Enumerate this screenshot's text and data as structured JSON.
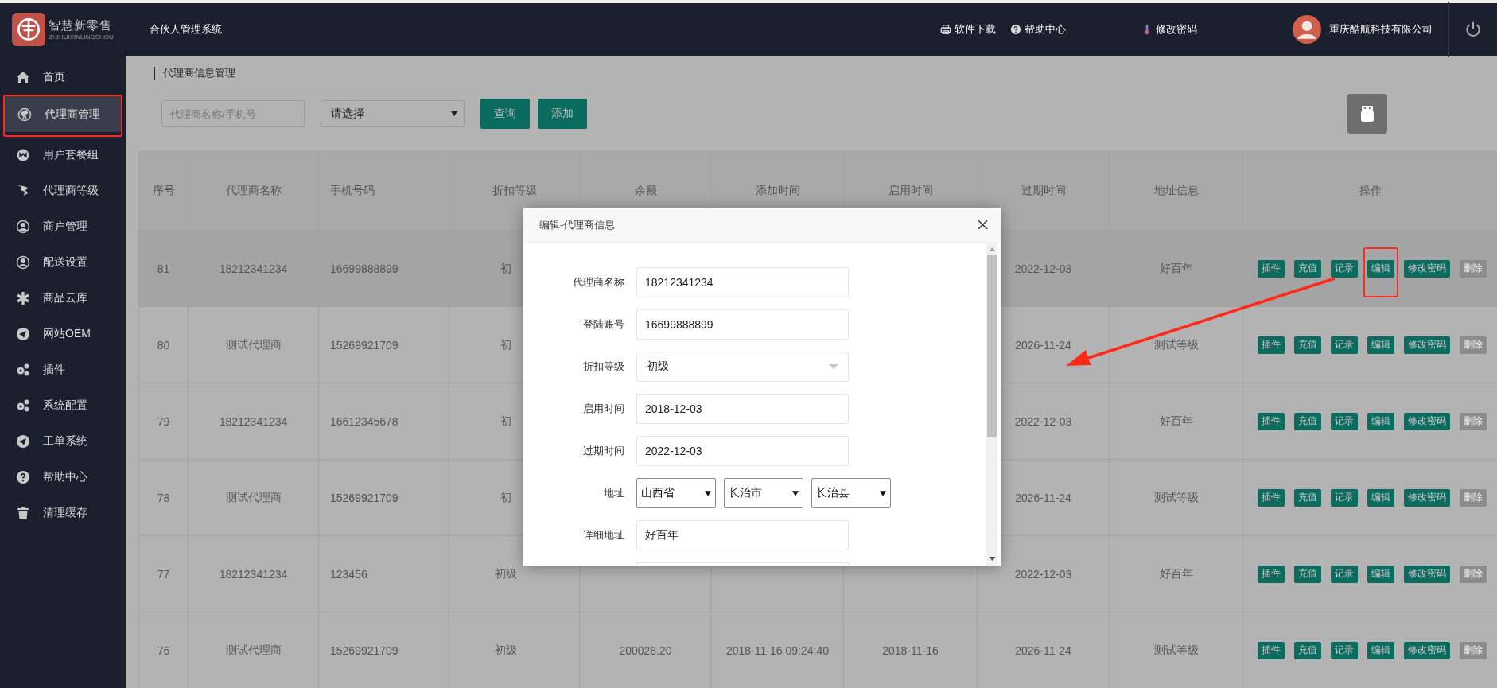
{
  "brand": {
    "name": "智慧新零售",
    "subtitle": "ZHIHUIXINLINGSHOU"
  },
  "system_title": "合伙人管理系统",
  "top_links": [
    {
      "label": "软件下载"
    },
    {
      "label": "帮助中心"
    },
    {
      "label": "修改密码"
    }
  ],
  "user": {
    "company": "重庆酷航科技有限公司"
  },
  "sidebar": {
    "items": [
      {
        "label": "首页",
        "selected": false,
        "highlighted": false
      },
      {
        "label": "代理商管理",
        "selected": true,
        "highlighted": true
      },
      {
        "label": "用户套餐组",
        "selected": false,
        "highlighted": false
      },
      {
        "label": "代理商等级",
        "selected": false,
        "highlighted": false
      },
      {
        "label": "商户管理",
        "selected": false,
        "highlighted": false
      },
      {
        "label": "配送设置",
        "selected": false,
        "highlighted": false
      },
      {
        "label": "商品云库",
        "selected": false,
        "highlighted": false
      },
      {
        "label": "网站OEM",
        "selected": false,
        "highlighted": false
      },
      {
        "label": "插件",
        "selected": false,
        "highlighted": false
      },
      {
        "label": "系统配置",
        "selected": false,
        "highlighted": false
      },
      {
        "label": "工单系统",
        "selected": false,
        "highlighted": false
      },
      {
        "label": "帮助中心",
        "selected": false,
        "highlighted": false
      },
      {
        "label": "清理缓存",
        "selected": false,
        "highlighted": false
      }
    ]
  },
  "breadcrumb": "代理商信息管理",
  "filters": {
    "search": {
      "placeholder": "代理商名称/手机号"
    },
    "select": {
      "value": "请选择"
    },
    "buttons": [
      "查询",
      "添加"
    ]
  },
  "table": {
    "columns": [
      "序号",
      "代理商名称",
      "手机号码",
      "折扣等级",
      "余额",
      "添加时间",
      "启用时间",
      "过期时间",
      "地址信息",
      "操作"
    ],
    "rows": [
      {
        "no": "81",
        "name": "18212341234",
        "phone": "16699888899",
        "discount": "初",
        "expire_time": "2022-12-03",
        "address": "好百年",
        "hovered": true,
        "actions": [
          {
            "label": "插件",
            "disabled": false,
            "highlighted": false
          },
          {
            "label": "充值",
            "disabled": false,
            "highlighted": false
          },
          {
            "label": "记录",
            "disabled": false,
            "highlighted": false
          },
          {
            "label": "编辑",
            "disabled": false,
            "highlighted": true
          },
          {
            "label": "修改密码",
            "disabled": false,
            "highlighted": false
          },
          {
            "label": "删除",
            "disabled": true,
            "highlighted": false
          }
        ]
      },
      {
        "no": "80",
        "name": "测试代理商",
        "phone": "15269921709",
        "discount": "初",
        "expire_time": "2026-11-24",
        "address": "测试等级",
        "hovered": false,
        "actions": [
          {
            "label": "插件",
            "disabled": false,
            "highlighted": false
          },
          {
            "label": "充值",
            "disabled": false,
            "highlighted": false
          },
          {
            "label": "记录",
            "disabled": false,
            "highlighted": false
          },
          {
            "label": "编辑",
            "disabled": false,
            "highlighted": false
          },
          {
            "label": "修改密码",
            "disabled": false,
            "highlighted": false
          },
          {
            "label": "删除",
            "disabled": true,
            "highlighted": false
          }
        ]
      },
      {
        "no": "79",
        "name": "18212341234",
        "phone": "16612345678",
        "discount": "初",
        "expire_time": "2022-12-03",
        "address": "好百年",
        "hovered": false,
        "actions": [
          {
            "label": "插件",
            "disabled": false,
            "highlighted": false
          },
          {
            "label": "充值",
            "disabled": false,
            "highlighted": false
          },
          {
            "label": "记录",
            "disabled": false,
            "highlighted": false
          },
          {
            "label": "编辑",
            "disabled": false,
            "highlighted": false
          },
          {
            "label": "修改密码",
            "disabled": false,
            "highlighted": false
          },
          {
            "label": "删除",
            "disabled": true,
            "highlighted": false
          }
        ]
      },
      {
        "no": "78",
        "name": "测试代理商",
        "phone": "15269921709",
        "discount": "初",
        "expire_time": "2026-11-24",
        "address": "测试等级",
        "hovered": false,
        "actions": [
          {
            "label": "插件",
            "disabled": false,
            "highlighted": false
          },
          {
            "label": "充值",
            "disabled": false,
            "highlighted": false
          },
          {
            "label": "记录",
            "disabled": false,
            "highlighted": false
          },
          {
            "label": "编辑",
            "disabled": false,
            "highlighted": false
          },
          {
            "label": "修改密码",
            "disabled": false,
            "highlighted": false
          },
          {
            "label": "删除",
            "disabled": true,
            "highlighted": false
          }
        ]
      },
      {
        "no": "77",
        "name": "18212341234",
        "phone": "123456",
        "discount": "初级",
        "expire_time": "2022-12-03",
        "address": "好百年",
        "hovered": false,
        "actions": [
          {
            "label": "插件",
            "disabled": false,
            "highlighted": false
          },
          {
            "label": "充值",
            "disabled": false,
            "highlighted": false
          },
          {
            "label": "记录",
            "disabled": false,
            "highlighted": false
          },
          {
            "label": "编辑",
            "disabled": false,
            "highlighted": false
          },
          {
            "label": "修改密码",
            "disabled": false,
            "highlighted": false
          },
          {
            "label": "删除",
            "disabled": true,
            "highlighted": false
          }
        ]
      },
      {
        "no": "76",
        "name": "测试代理商",
        "phone": "15269921709",
        "discount": "初级",
        "balance": "200028.20",
        "added_time": "2018-11-16 09:24:40",
        "start_time": "2018-11-16",
        "expire_time": "2026-11-24",
        "address": "测试等级",
        "hovered": false,
        "actions": [
          {
            "label": "插件",
            "disabled": false,
            "highlighted": false
          },
          {
            "label": "充值",
            "disabled": false,
            "highlighted": false
          },
          {
            "label": "记录",
            "disabled": false,
            "highlighted": false
          },
          {
            "label": "编辑",
            "disabled": false,
            "highlighted": false
          },
          {
            "label": "修改密码",
            "disabled": false,
            "highlighted": false
          },
          {
            "label": "删除",
            "disabled": true,
            "highlighted": false
          }
        ]
      }
    ]
  },
  "modal": {
    "title": "编辑-代理商信息",
    "fields": [
      {
        "kind": "text",
        "label": "代理商名称",
        "value": "18212341234"
      },
      {
        "kind": "text",
        "label": "登陆账号",
        "value": "16699888899"
      },
      {
        "kind": "select",
        "label": "折扣等级",
        "value": "初级"
      },
      {
        "kind": "text",
        "label": "启用时间",
        "value": "2018-12-03"
      },
      {
        "kind": "text",
        "label": "过期时间",
        "value": "2022-12-03"
      },
      {
        "kind": "address",
        "label": "地址",
        "values": [
          "山西省",
          "长治市",
          "长治县"
        ]
      },
      {
        "kind": "text",
        "label": "详细地址",
        "value": "好百年"
      },
      {
        "kind": "text"
      }
    ]
  },
  "annotation_arrow": true
}
